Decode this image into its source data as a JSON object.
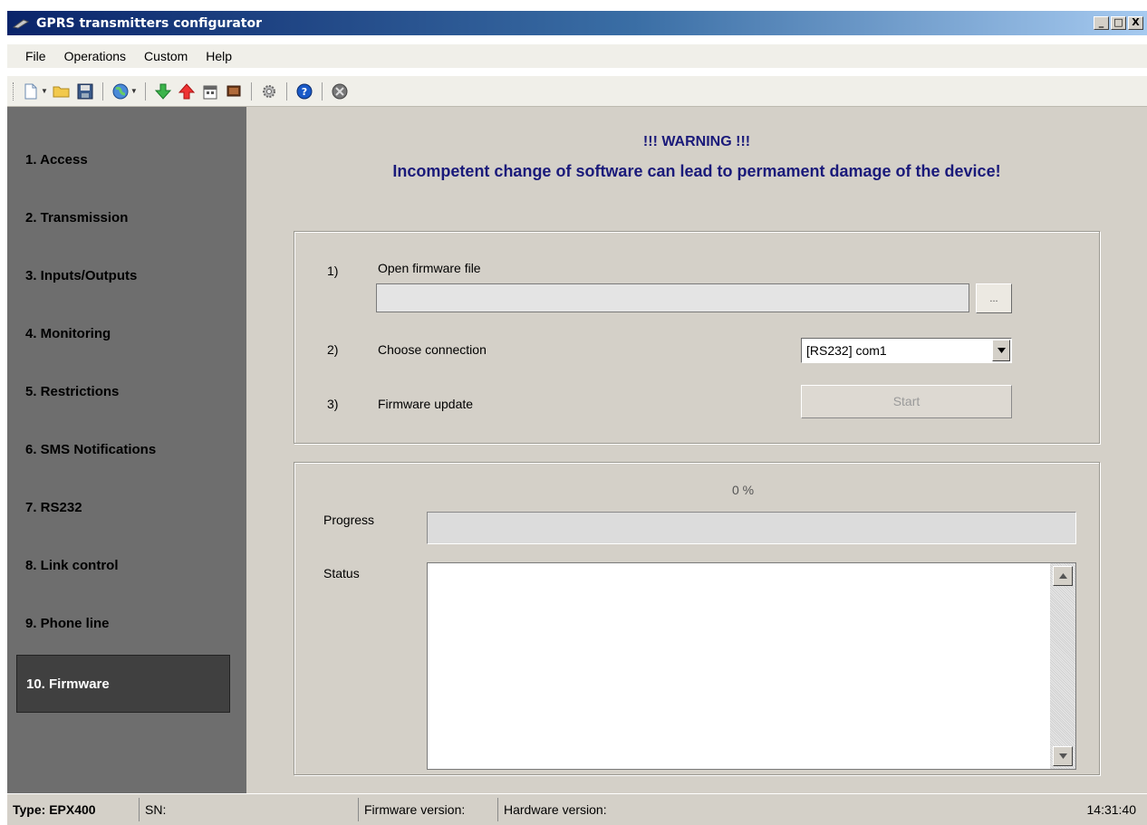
{
  "window": {
    "title": "GPRS transmitters configurator",
    "controls": [
      "_",
      "□",
      "X"
    ]
  },
  "menu": [
    "File",
    "Operations",
    "Custom",
    "Help"
  ],
  "toolbar": {
    "icons": [
      "new-icon",
      "open-folder-icon",
      "save-icon",
      "globe-icon",
      "download-arrow-icon",
      "upload-arrow-icon",
      "calendar-icon",
      "monitor-icon",
      "settings-gear-icon",
      "help-icon",
      "exit-icon"
    ]
  },
  "sidebar": {
    "items": [
      {
        "label": "1. Access"
      },
      {
        "label": "2. Transmission"
      },
      {
        "label": "3. Inputs/Outputs"
      },
      {
        "label": "4. Monitoring"
      },
      {
        "label": "5. Restrictions"
      },
      {
        "label": "6. SMS Notifications"
      },
      {
        "label": "7. RS232"
      },
      {
        "label": "8. Link control"
      },
      {
        "label": "9. Phone line"
      },
      {
        "label": "10. Firmware"
      }
    ],
    "active_index": 9
  },
  "warning": {
    "title": "!!! WARNING !!!",
    "message": "Incompetent change of software can lead to permament damage of the device!",
    "color": "#1a1a7a"
  },
  "firmware": {
    "step1": {
      "number": "1)",
      "label": "Open firmware file",
      "path_value": "",
      "browse_label": "..."
    },
    "step2": {
      "number": "2)",
      "label": "Choose connection",
      "selected": "[RS232] com1"
    },
    "step3": {
      "number": "3)",
      "label": "Firmware update",
      "start_label": "Start"
    }
  },
  "progress": {
    "percent_text": "0 %",
    "value": 0,
    "label": "Progress",
    "status_label": "Status",
    "status_text": ""
  },
  "statusbar": {
    "type": "Type: EPX400",
    "sn": "SN:",
    "firmware_version": "Firmware version:",
    "hardware_version": "Hardware version:",
    "time": "14:31:40"
  }
}
